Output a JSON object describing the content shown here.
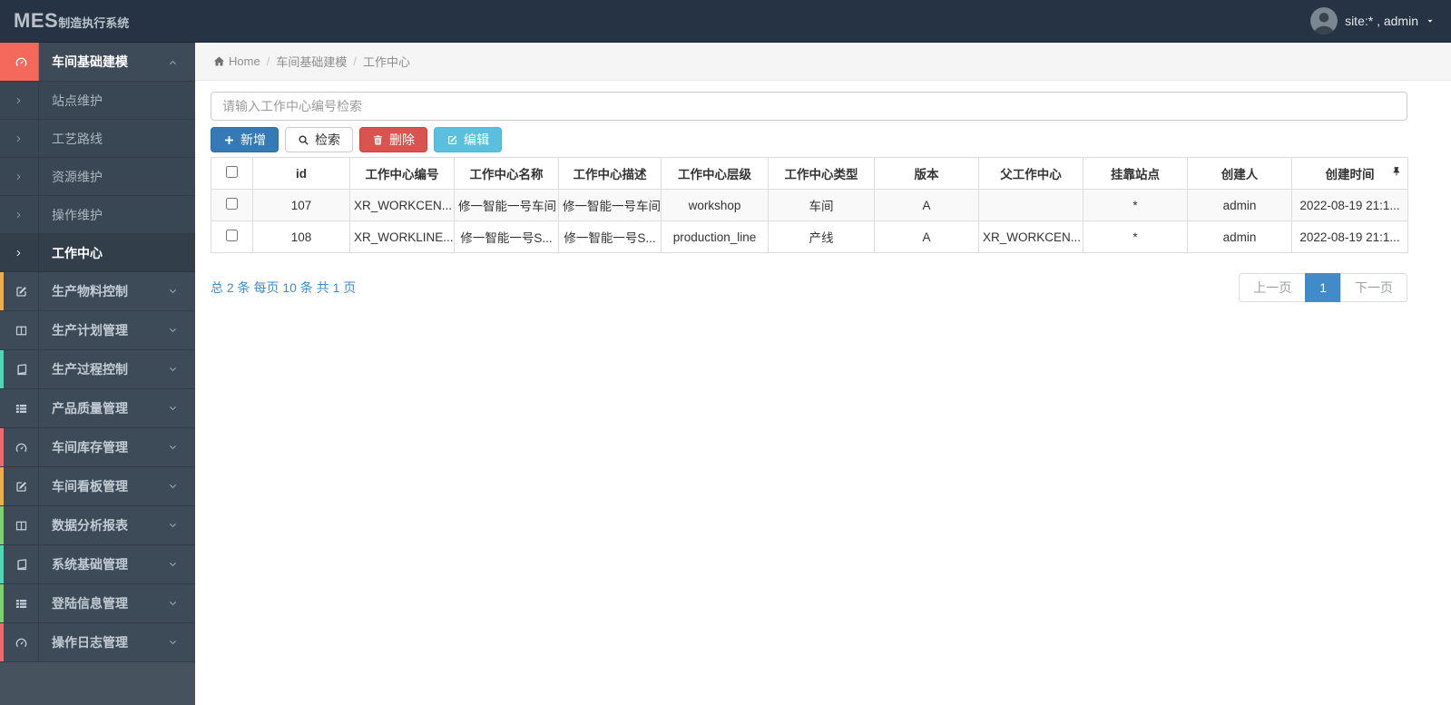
{
  "app": {
    "brand_primary": "MES",
    "brand_secondary": "制造执行系统",
    "user_label": "site:* , admin"
  },
  "breadcrumb": {
    "items": [
      {
        "label": "Home",
        "icon": "home-icon"
      },
      {
        "label": "车间基础建模"
      },
      {
        "label": "工作中心"
      }
    ]
  },
  "sidebar": {
    "items": [
      {
        "label": "车间基础建模",
        "icon": "dashboard-icon",
        "accent": "#f4695c",
        "active": true,
        "chevron": "up",
        "children": [
          {
            "label": "站点维护"
          },
          {
            "label": "工艺路线"
          },
          {
            "label": "资源维护"
          },
          {
            "label": "操作维护"
          },
          {
            "label": "工作中心",
            "active": true
          }
        ]
      },
      {
        "label": "生产物料控制",
        "icon": "pencil-square-icon",
        "accent": "#f0ad4e",
        "chevron": "down"
      },
      {
        "label": "生产计划管理",
        "icon": "columns-icon",
        "accent": "",
        "chevron": "down"
      },
      {
        "label": "生产过程控制",
        "icon": "book-icon",
        "accent": "#4fd6b3",
        "chevron": "down"
      },
      {
        "label": "产品质量管理",
        "icon": "list-icon",
        "accent": "",
        "chevron": "down"
      },
      {
        "label": "车间库存管理",
        "icon": "dashboard-icon",
        "accent": "#ef6a6a",
        "chevron": "down"
      },
      {
        "label": "车间看板管理",
        "icon": "pencil-square-icon",
        "accent": "#f0ad4e",
        "chevron": "down"
      },
      {
        "label": "数据分析报表",
        "icon": "columns-icon",
        "accent": "#7ed06f",
        "chevron": "down"
      },
      {
        "label": "系统基础管理",
        "icon": "book-icon",
        "accent": "#4fd6b3",
        "chevron": "down"
      },
      {
        "label": "登陆信息管理",
        "icon": "list-icon",
        "accent": "#7ed06f",
        "chevron": "down"
      },
      {
        "label": "操作日志管理",
        "icon": "dashboard-icon",
        "accent": "#ef6a6a",
        "chevron": "down"
      }
    ]
  },
  "toolbar": {
    "search_placeholder": "请输入工作中心编号检索",
    "buttons": [
      {
        "name": "add-button",
        "label": "新增",
        "icon": "plus-icon",
        "variant": "primary"
      },
      {
        "name": "search-button",
        "label": "检索",
        "icon": "search-icon",
        "variant": "default"
      },
      {
        "name": "delete-button",
        "label": "删除",
        "icon": "trash-icon",
        "variant": "danger"
      },
      {
        "name": "edit-button",
        "label": "编辑",
        "icon": "edit-icon",
        "variant": "info"
      }
    ]
  },
  "table": {
    "columns": [
      "id",
      "工作中心编号",
      "工作中心名称",
      "工作中心描述",
      "工作中心层级",
      "工作中心类型",
      "版本",
      "父工作中心",
      "挂靠站点",
      "创建人",
      "创建时间"
    ],
    "pin_icon": "pin-icon",
    "rows": [
      {
        "cells": [
          "107",
          "XR_WORKCEN...",
          "修一智能一号车间",
          "修一智能一号车间",
          "workshop",
          "车间",
          "A",
          "",
          "*",
          "admin",
          "2022-08-19 21:1..."
        ]
      },
      {
        "cells": [
          "108",
          "XR_WORKLINE...",
          "修一智能一号S...",
          "修一智能一号S...",
          "production_line",
          "产线",
          "A",
          "XR_WORKCEN...",
          "*",
          "admin",
          "2022-08-19 21:1..."
        ]
      }
    ]
  },
  "pagination": {
    "summary": "总 2 条 每页 10 条 共 1 页",
    "prev_label": "上一页",
    "current_page": "1",
    "next_label": "下一页"
  },
  "colors": {
    "navbar": "#263344",
    "sidebar": "#46525d",
    "active_accent": "#f4695c",
    "primary": "#337ab7",
    "danger": "#d9534f",
    "info": "#5bc0de",
    "link": "#428bca"
  }
}
